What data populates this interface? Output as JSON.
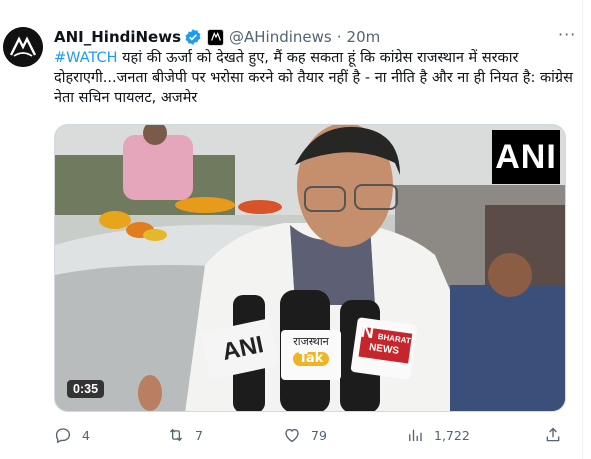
{
  "tweet": {
    "display_name": "ANI_HindiNews",
    "handle": "@AHindinews",
    "separator": "·",
    "time": "20m",
    "hashtag": "#WATCH",
    "body": " यहां की ऊर्जा को देखते हुए, मैं कह सकता हूं कि कांग्रेस राजस्थान में सरकार दोहराएगी...जनता बीजेपी पर भरोसा करने को तैयार नहीं है - ना नीति है और ना ही नियत है: कांग्रेस नेता सचिन पायलट, अजमेर",
    "more_label": "···"
  },
  "media": {
    "watermark": "ANI",
    "duration": "0:35",
    "mic_labels": {
      "ani": "ANI",
      "rajasthan_tak_top": "राजस्थान",
      "rajasthan_tak_bottom": "Tak",
      "news_n": "N",
      "news_bharat": "BHARAT",
      "news_word": "NEWS"
    }
  },
  "actions": {
    "replies": "4",
    "retweets": "7",
    "likes": "79",
    "views": "1,722"
  },
  "colors": {
    "accent": "#1d9bf0",
    "muted": "#536471",
    "text": "#0f1419",
    "verified": "#1d9bf0"
  },
  "icons": {
    "reply": "comment-icon",
    "retweet": "retweet-icon",
    "like": "heart-icon",
    "views": "bar-chart-icon",
    "share": "share-icon",
    "verified": "verified-badge-icon"
  }
}
